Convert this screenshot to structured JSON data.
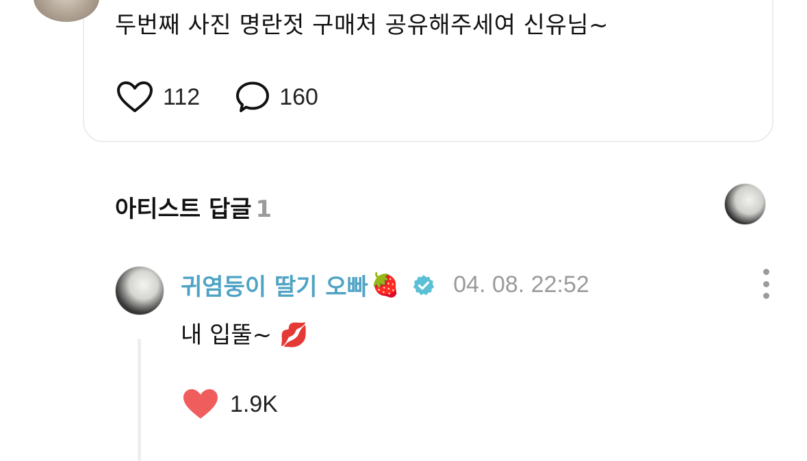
{
  "post": {
    "text": "두번째 사진 명란젓 구매처 공유해주세여 신유님~",
    "likes": "112",
    "comments": "160"
  },
  "artist_replies": {
    "title": "아티스트 답글",
    "count": "1"
  },
  "reply": {
    "author": "귀염둥이 딸기 오빠",
    "author_emoji": "🍓",
    "timestamp": "04. 08. 22:52",
    "text": "내 입뚤~ 💋",
    "likes": "1.9K"
  },
  "colors": {
    "author": "#4fa3c4",
    "verified": "#5bc0d6",
    "liked_heart": "#f05d5d",
    "muted": "#9a9a9a"
  },
  "icons": [
    "heart-outline-icon",
    "comment-bubble-icon",
    "verified-badge-icon",
    "more-vertical-icon",
    "heart-filled-icon"
  ]
}
